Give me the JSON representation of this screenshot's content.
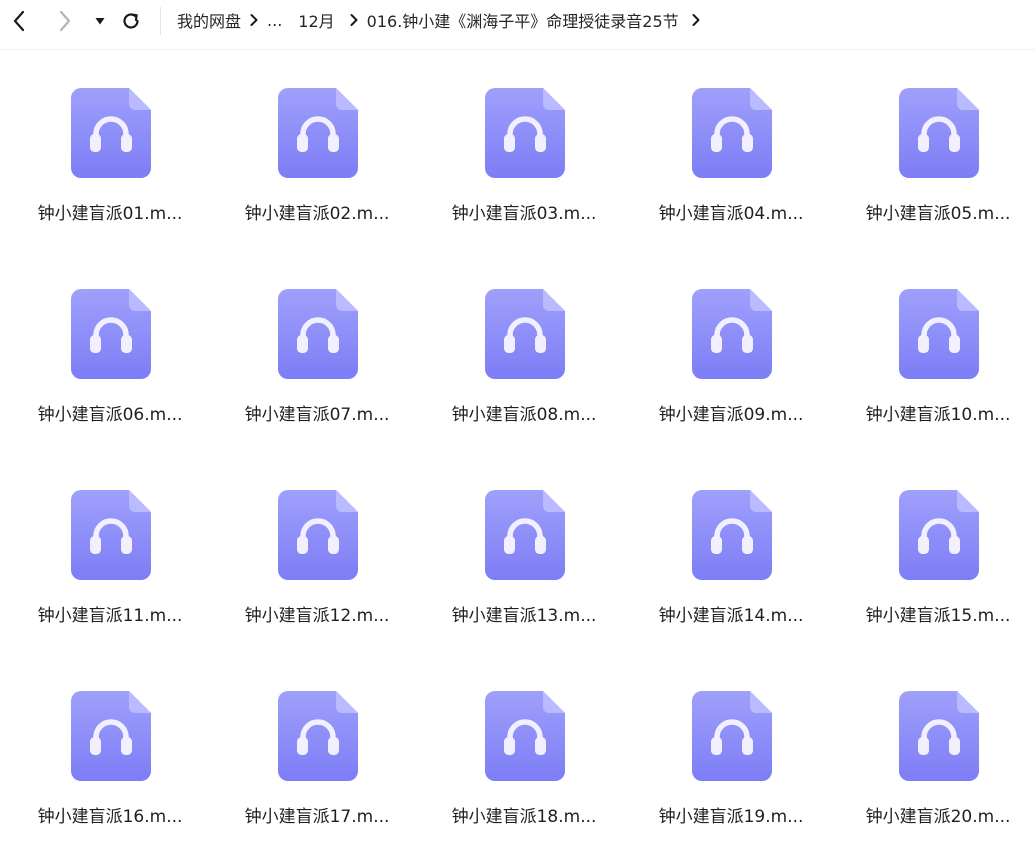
{
  "toolbar": {
    "back_icon": "chevron-left-icon",
    "forward_icon": "chevron-right-icon",
    "history_icon": "caret-down-icon",
    "refresh_icon": "refresh-icon"
  },
  "breadcrumb": {
    "root": "我的网盘",
    "ellipsis": "...",
    "parent": "12月",
    "current": "016.钟小建《渊海子平》命理授徒录音25节"
  },
  "colors": {
    "icon_top": "#9fa0fb",
    "icon_bottom": "#7d7df6",
    "icon_fold": "#b9baff",
    "headphone": "#f2f0ff"
  },
  "files": [
    {
      "name": "钟小建盲派01.m...",
      "icon": "audio-file-icon"
    },
    {
      "name": "钟小建盲派02.m...",
      "icon": "audio-file-icon"
    },
    {
      "name": "钟小建盲派03.m...",
      "icon": "audio-file-icon"
    },
    {
      "name": "钟小建盲派04.m...",
      "icon": "audio-file-icon"
    },
    {
      "name": "钟小建盲派05.m...",
      "icon": "audio-file-icon"
    },
    {
      "name": "钟小建盲派06.m...",
      "icon": "audio-file-icon"
    },
    {
      "name": "钟小建盲派07.m...",
      "icon": "audio-file-icon"
    },
    {
      "name": "钟小建盲派08.m...",
      "icon": "audio-file-icon"
    },
    {
      "name": "钟小建盲派09.m...",
      "icon": "audio-file-icon"
    },
    {
      "name": "钟小建盲派10.m...",
      "icon": "audio-file-icon"
    },
    {
      "name": "钟小建盲派11.m...",
      "icon": "audio-file-icon"
    },
    {
      "name": "钟小建盲派12.m...",
      "icon": "audio-file-icon"
    },
    {
      "name": "钟小建盲派13.m...",
      "icon": "audio-file-icon"
    },
    {
      "name": "钟小建盲派14.m...",
      "icon": "audio-file-icon"
    },
    {
      "name": "钟小建盲派15.m...",
      "icon": "audio-file-icon"
    },
    {
      "name": "钟小建盲派16.m...",
      "icon": "audio-file-icon"
    },
    {
      "name": "钟小建盲派17.m...",
      "icon": "audio-file-icon"
    },
    {
      "name": "钟小建盲派18.m...",
      "icon": "audio-file-icon"
    },
    {
      "name": "钟小建盲派19.m...",
      "icon": "audio-file-icon"
    },
    {
      "name": "钟小建盲派20.m...",
      "icon": "audio-file-icon"
    }
  ]
}
